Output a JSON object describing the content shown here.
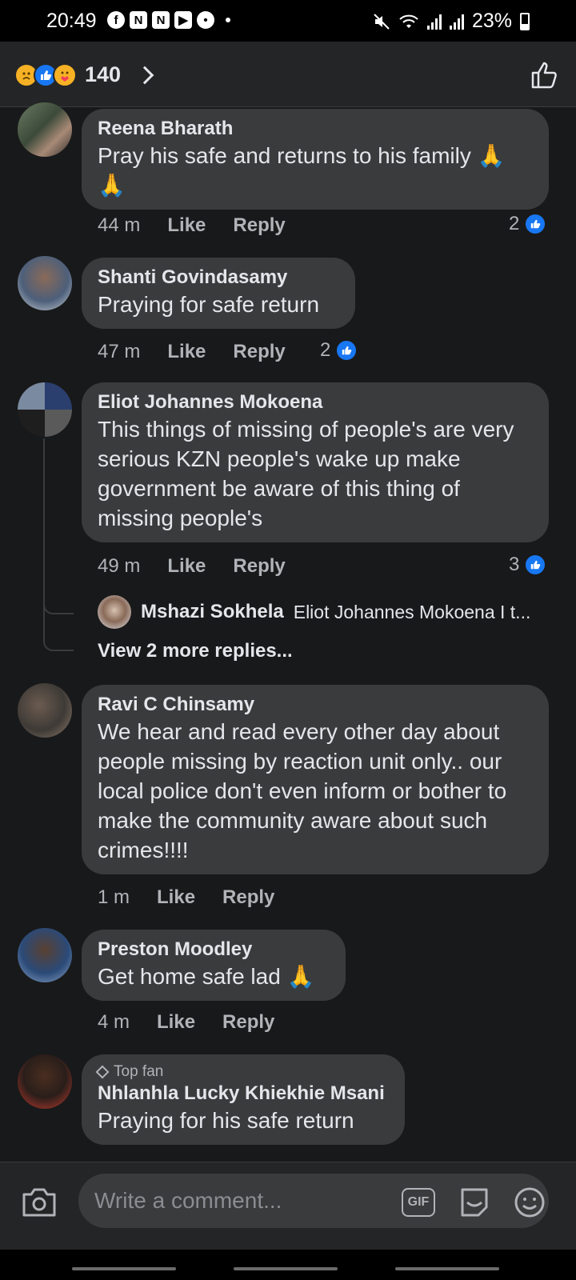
{
  "status_bar": {
    "time": "20:49",
    "battery": "23%"
  },
  "header": {
    "reaction_count": "140"
  },
  "comments": [
    {
      "author": "Reena Bharath",
      "text": "Pray his safe and returns to his family 🙏🙏",
      "time": "44 m",
      "like_label": "Like",
      "reply_label": "Reply",
      "likes": "2"
    },
    {
      "author": "Shanti Govindasamy",
      "text": "Praying for safe return",
      "time": "47 m",
      "like_label": "Like",
      "reply_label": "Reply",
      "likes": "2"
    },
    {
      "author": "Eliot Johannes Mokoena",
      "text": "This things of missing of people's are very serious KZN people's wake up make government be aware of this thing of missing people's",
      "time": "49 m",
      "like_label": "Like",
      "reply_label": "Reply",
      "likes": "3",
      "reply_preview": {
        "author": "Mshazi Sokhela",
        "text": "Eliot Johannes Mokoena I t..."
      },
      "view_more": "View 2 more replies..."
    },
    {
      "author": "Ravi C Chinsamy",
      "text": "We hear and read every other day about people missing by reaction unit only.. our local police don't even inform or bother to make the community aware about such crimes!!!!",
      "time": "1 m",
      "like_label": "Like",
      "reply_label": "Reply"
    },
    {
      "author": "Preston Moodley",
      "text": "Get home safe lad 🙏",
      "time": "4 m",
      "like_label": "Like",
      "reply_label": "Reply"
    },
    {
      "badge": "Top fan",
      "author": "Nhlanhla Lucky Khiekhie Msani",
      "text": "Praying for his safe return"
    }
  ],
  "composer": {
    "placeholder": "Write a comment...",
    "gif_label": "GIF"
  },
  "colors": {
    "background": "#18191a",
    "bubble": "#3a3b3c",
    "accent": "#1877f2",
    "muted": "#b0b3b8"
  }
}
